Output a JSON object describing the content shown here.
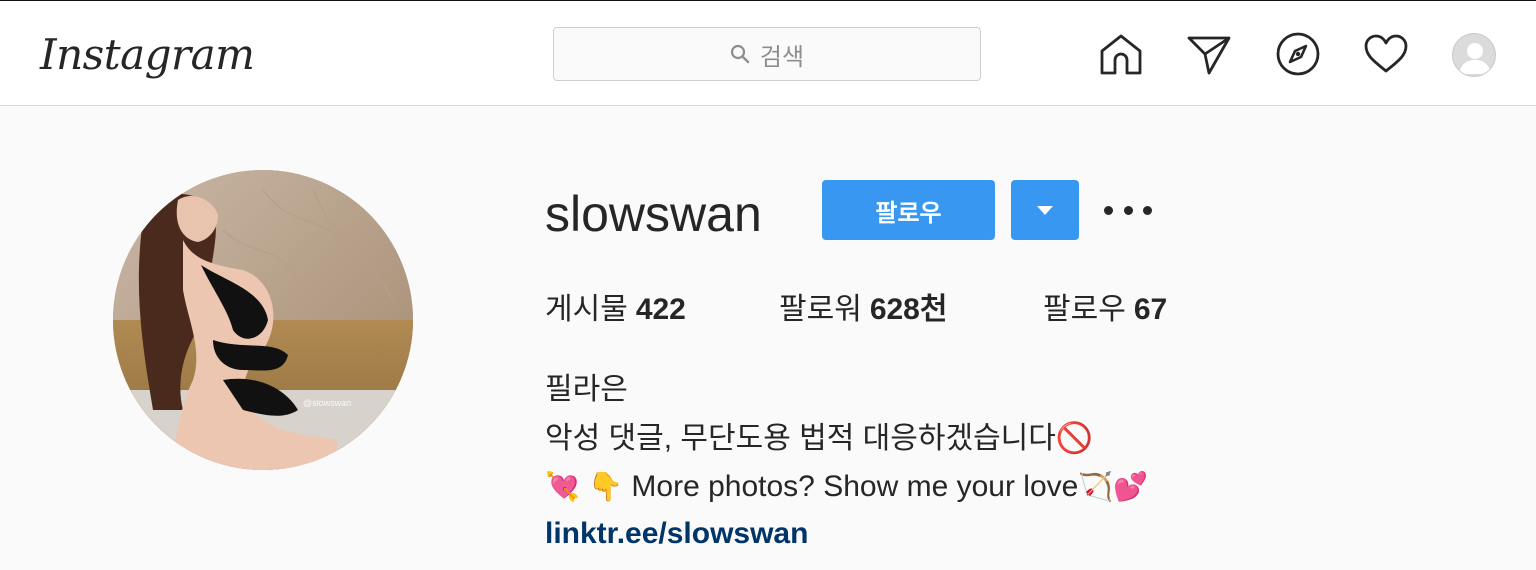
{
  "header": {
    "logo": "Instagram",
    "search_placeholder": "검색",
    "icons": [
      "home-icon",
      "direct-icon",
      "explore-icon",
      "activity-heart-icon",
      "profile-avatar-icon"
    ]
  },
  "profile": {
    "username": "slowswan",
    "follow_label": "팔로우",
    "watermark": "@slowswan",
    "stats": {
      "posts_label": "게시물",
      "posts_value": "422",
      "followers_label": "팔로워",
      "followers_value": "628천",
      "following_label": "팔로우",
      "following_value": "67"
    },
    "bio": {
      "name": "필라은",
      "line1": "악성 댓글, 무단도용 법적 대응하겠습니다🚫",
      "line2_emoji_a": "💘",
      "line2_emoji_b": "👇",
      "line2_text": " More photos? Show me your love",
      "line2_emoji_c": "🏹",
      "line2_emoji_d": "💕",
      "link": "linktr.ee/slowswan"
    }
  },
  "colors": {
    "accent": "#3897f0",
    "link": "#003569",
    "text": "#262626",
    "background": "#fafafa"
  }
}
